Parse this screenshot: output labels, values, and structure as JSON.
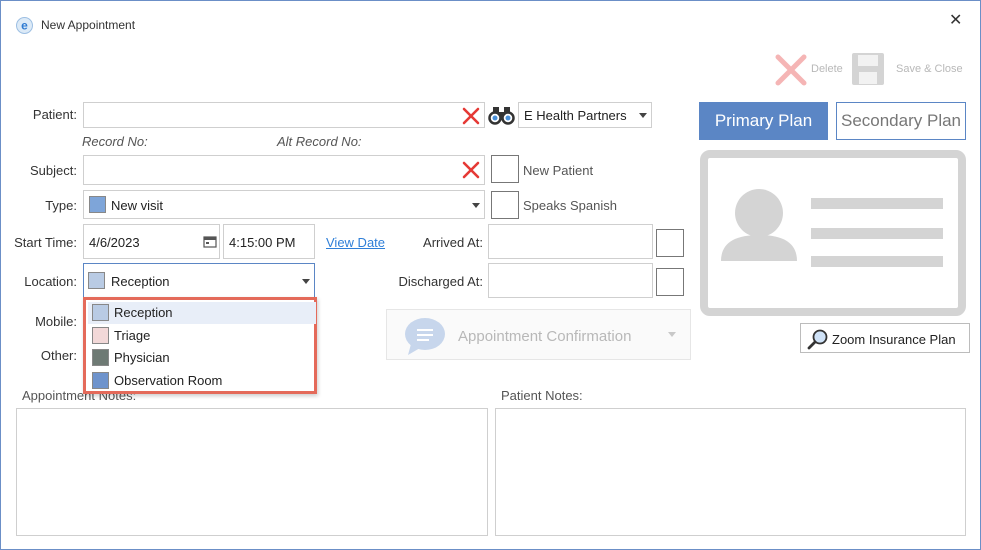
{
  "window": {
    "title": "New Appointment",
    "close_glyph": "✕"
  },
  "toolbar": {
    "delete_label": "Delete",
    "save_close_label": "Save & Close"
  },
  "patient": {
    "label": "Patient:",
    "value": ""
  },
  "record": {
    "record_no_label": "Record No:",
    "alt_record_no_label": "Alt Record No:"
  },
  "partner": {
    "value": "E Health Partners"
  },
  "subject": {
    "label": "Subject:",
    "value": ""
  },
  "new_patient": {
    "label": "New Patient",
    "checked": false
  },
  "type": {
    "label": "Type:",
    "value": "New visit",
    "color": "#7ea5d9"
  },
  "speaks_spanish": {
    "label": "Speaks Spanish",
    "checked": false
  },
  "start_time": {
    "label": "Start Time:",
    "date": "4/6/2023",
    "time": "4:15:00 PM",
    "view_date_link": "View Date"
  },
  "arrived_at": {
    "label": "Arrived At:",
    "value": ""
  },
  "discharged_at": {
    "label": "Discharged At:",
    "value": ""
  },
  "location": {
    "label": "Location:",
    "value": "Reception",
    "color": "#b9cbe4",
    "options": [
      {
        "label": "Reception",
        "color": "#b9cbe4",
        "selected": true
      },
      {
        "label": "Triage",
        "color": "#f2d8d8",
        "selected": false
      },
      {
        "label": "Physician",
        "color": "#6e7a74",
        "selected": false
      },
      {
        "label": "Observation Room",
        "color": "#6e93cc",
        "selected": false
      }
    ]
  },
  "mobile": {
    "label": "Mobile:"
  },
  "other": {
    "label": "Other:"
  },
  "appointment_confirmation": {
    "label": "Appointment Confirmation"
  },
  "insurance": {
    "primary_label": "Primary Plan",
    "secondary_label": "Secondary Plan",
    "zoom_label": "Zoom Insurance Plan"
  },
  "notes": {
    "appointment_label": "Appointment Notes:",
    "patient_label": "Patient Notes:"
  },
  "colors": {
    "accent": "#5b86c5",
    "clear_red": "#e53935",
    "dropdown_highlight": "#e46a5a"
  }
}
